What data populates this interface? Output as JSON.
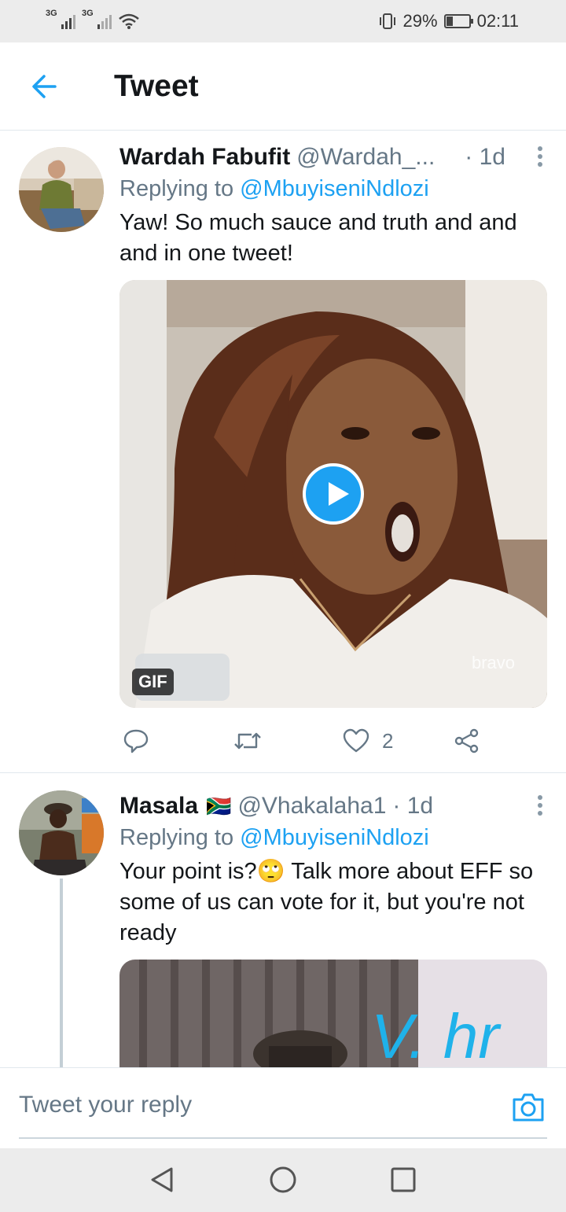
{
  "status_bar": {
    "network1": "3G",
    "network2": "3G",
    "battery_percent": "29%",
    "battery_level": 0.29,
    "time": "02:11"
  },
  "header": {
    "title": "Tweet"
  },
  "tweets": [
    {
      "name": "Wardah Fabufit",
      "handle": "@Wardah_...",
      "time": "· 1d",
      "replying_prefix": "Replying to",
      "replying_to": "@MbuyiseniNdlozi",
      "text": "Yaw! So much sauce and truth and and and in one tweet!",
      "media_badge": "GIF",
      "media_watermark": "bravo",
      "like_count": "2"
    },
    {
      "name": "Masala",
      "flag": "🇿🇦",
      "handle": "@Vhakalaha1",
      "time": "· 1d",
      "replying_prefix": "Replying to",
      "replying_to": "@MbuyiseniNdlozi",
      "text": "Your point is?🙄 Talk more about EFF so some of us can vote for it, but you're not ready",
      "media_scribble": "V. hr"
    }
  ],
  "reply": {
    "placeholder": "Tweet your reply"
  },
  "colors": {
    "accent": "#1da1f2",
    "secondary_text": "#657786",
    "primary_text": "#14171a"
  },
  "icons": {
    "back": "arrow-left-icon",
    "more": "more-vertical-icon",
    "reply": "reply-icon",
    "retweet": "retweet-icon",
    "like": "heart-icon",
    "share": "share-icon",
    "camera": "camera-icon"
  }
}
